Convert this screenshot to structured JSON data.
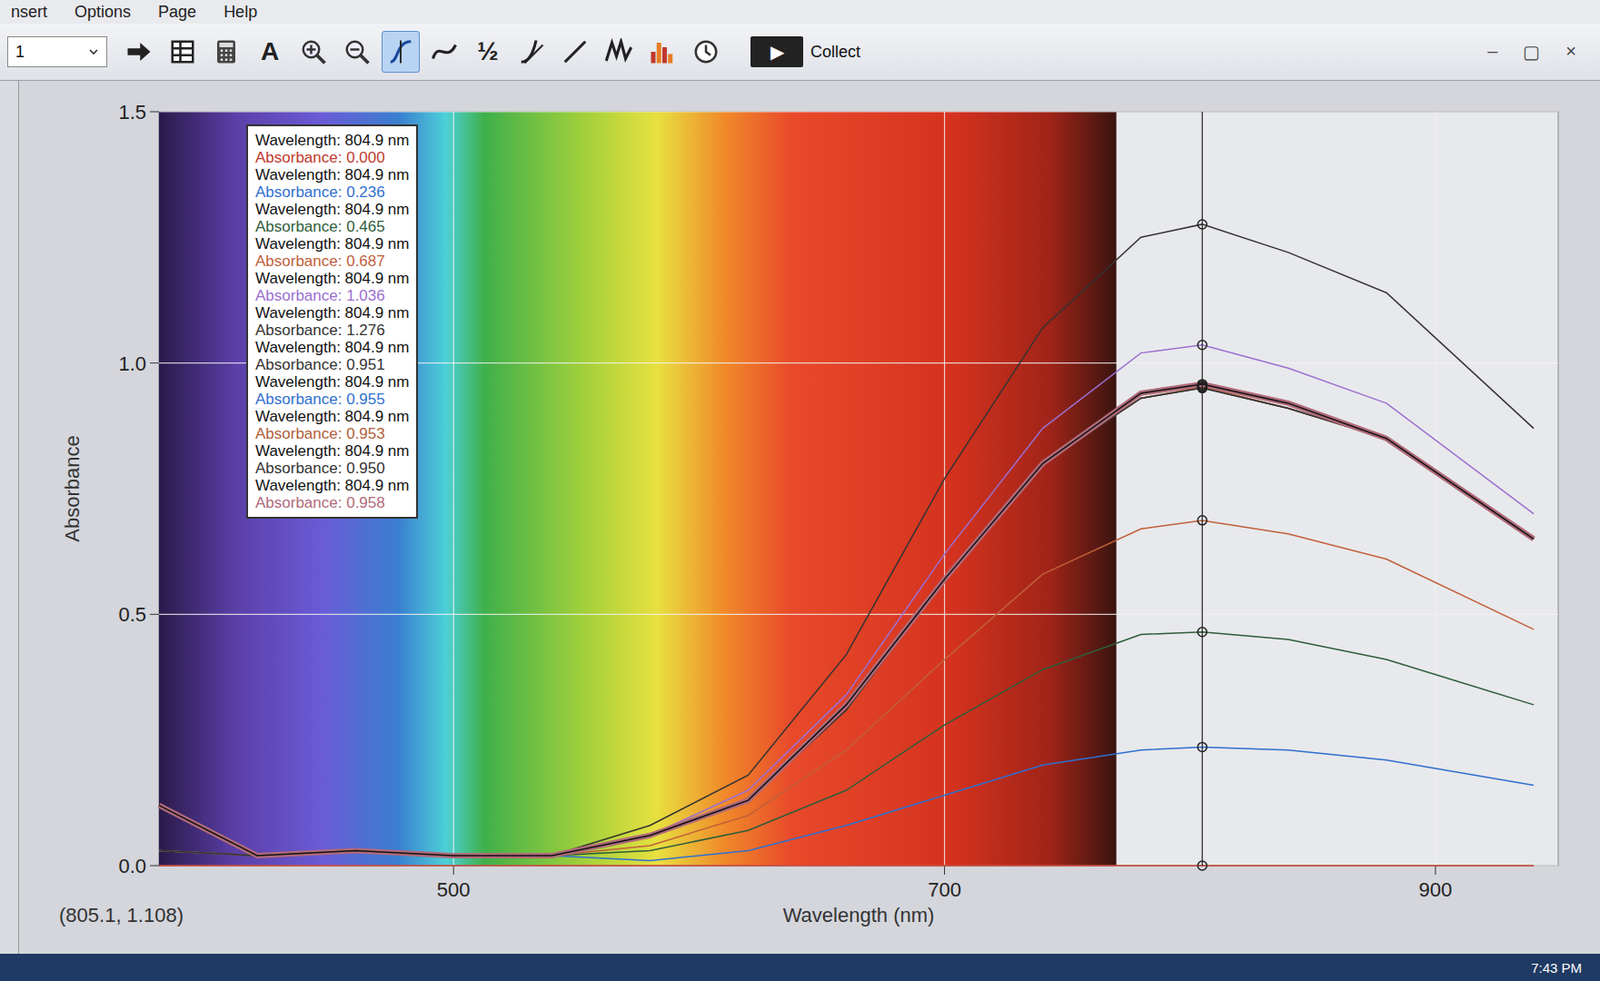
{
  "window": {
    "controls": [
      "–",
      "▢",
      "×"
    ]
  },
  "menu": [
    {
      "label": "nsert"
    },
    {
      "label": "Options"
    },
    {
      "label": "Page"
    },
    {
      "label": "Help"
    }
  ],
  "toolbar": {
    "page_select": "1",
    "buttons": [
      {
        "kind": "arrow",
        "selected": false
      },
      {
        "kind": "table",
        "selected": false
      },
      {
        "kind": "calculator",
        "selected": false
      },
      {
        "kind": "glyph",
        "label": "A",
        "selected": false
      },
      {
        "kind": "zoomin",
        "selected": false
      },
      {
        "kind": "zoomout",
        "selected": false
      },
      {
        "kind": "examine",
        "selected": true
      },
      {
        "kind": "curve",
        "selected": false
      },
      {
        "kind": "glyph",
        "label": "½",
        "selected": false
      },
      {
        "kind": "tangent",
        "selected": false
      },
      {
        "kind": "linear",
        "selected": false
      },
      {
        "kind": "peaks",
        "selected": false
      },
      {
        "kind": "histogram",
        "selected": false
      },
      {
        "kind": "clock",
        "selected": false
      }
    ],
    "collect": {
      "icon": "▶",
      "label": "Collect"
    }
  },
  "chart": {
    "y_axis": {
      "title": "Absorbance",
      "range": [
        0,
        1.5
      ],
      "ticks": [
        {
          "label": "0.0",
          "value": 0
        },
        {
          "label": "0.5",
          "value": 0.5
        },
        {
          "label": "1.0",
          "value": 1.0
        },
        {
          "label": "1.5",
          "value": 1.5
        }
      ]
    },
    "x_axis": {
      "title": "Wavelength (nm)",
      "range": [
        380,
        950
      ],
      "ticks": [
        {
          "label": "500",
          "value": 500
        },
        {
          "label": "700",
          "value": 700
        },
        {
          "label": "900",
          "value": 900
        }
      ]
    },
    "x_values": [
      380,
      420,
      460,
      500,
      540,
      580,
      620,
      660,
      700,
      740,
      780,
      805,
      840,
      880,
      940
    ],
    "cursor": {
      "wavelength": 805
    },
    "series": [
      {
        "wavelength": "Wavelength: 804.9 nm",
        "absorbance": "Absorbance: 0.000",
        "color": "#c0392b",
        "highlighted": false,
        "values": [
          0,
          0,
          0,
          0,
          0,
          0,
          0,
          0,
          0,
          0,
          0,
          0,
          0,
          0,
          0
        ]
      },
      {
        "wavelength": "Wavelength: 804.9 nm",
        "absorbance": "Absorbance: 0.236",
        "color": "#2f6fd0",
        "highlighted": false,
        "values": [
          0.03,
          0.02,
          0.03,
          0.02,
          0.02,
          0.01,
          0.03,
          0.08,
          0.14,
          0.2,
          0.23,
          0.236,
          0.23,
          0.21,
          0.16
        ]
      },
      {
        "wavelength": "Wavelength: 804.9 nm",
        "absorbance": "Absorbance: 0.465",
        "color": "#2e5d3a",
        "highlighted": false,
        "values": [
          0.03,
          0.02,
          0.03,
          0.02,
          0.02,
          0.03,
          0.07,
          0.15,
          0.28,
          0.39,
          0.46,
          0.465,
          0.45,
          0.41,
          0.32
        ]
      },
      {
        "wavelength": "Wavelength: 804.9 nm",
        "absorbance": "Absorbance: 0.687",
        "color": "#c0603a",
        "highlighted": false,
        "values": [
          0.03,
          0.02,
          0.03,
          0.02,
          0.02,
          0.04,
          0.1,
          0.23,
          0.41,
          0.58,
          0.67,
          0.687,
          0.66,
          0.61,
          0.47
        ]
      },
      {
        "wavelength": "Wavelength: 804.9 nm",
        "absorbance": "Absorbance: 1.036",
        "color": "#9b6fd0",
        "highlighted": false,
        "values": [
          0.03,
          0.02,
          0.03,
          0.02,
          0.02,
          0.06,
          0.15,
          0.34,
          0.62,
          0.87,
          1.02,
          1.036,
          0.99,
          0.92,
          0.7
        ]
      },
      {
        "wavelength": "Wavelength: 804.9 nm",
        "absorbance": "Absorbance: 1.276",
        "color": "#333333",
        "highlighted": false,
        "values": [
          0.03,
          0.02,
          0.03,
          0.02,
          0.02,
          0.08,
          0.18,
          0.42,
          0.77,
          1.07,
          1.25,
          1.276,
          1.22,
          1.14,
          0.87
        ]
      },
      {
        "wavelength": "Wavelength: 804.9 nm",
        "absorbance": "Absorbance: 0.951",
        "color": "#333333",
        "highlighted": false,
        "values": [
          0.03,
          0.02,
          0.03,
          0.02,
          0.02,
          0.06,
          0.13,
          0.31,
          0.57,
          0.8,
          0.93,
          0.951,
          0.91,
          0.85,
          0.65
        ]
      },
      {
        "wavelength": "Wavelength: 804.9 nm",
        "absorbance": "Absorbance: 0.955",
        "color": "#2f6fd0",
        "highlighted": false,
        "values": [
          0.03,
          0.02,
          0.03,
          0.02,
          0.02,
          0.06,
          0.13,
          0.32,
          0.57,
          0.8,
          0.94,
          0.955,
          0.92,
          0.85,
          0.65
        ]
      },
      {
        "wavelength": "Wavelength: 804.9 nm",
        "absorbance": "Absorbance: 0.953",
        "color": "#b0603a",
        "highlighted": false,
        "values": [
          0.03,
          0.02,
          0.03,
          0.02,
          0.02,
          0.06,
          0.13,
          0.31,
          0.57,
          0.8,
          0.93,
          0.953,
          0.91,
          0.85,
          0.65
        ]
      },
      {
        "wavelength": "Wavelength: 804.9 nm",
        "absorbance": "Absorbance: 0.950",
        "color": "#333333",
        "highlighted": false,
        "values": [
          0.03,
          0.02,
          0.03,
          0.02,
          0.02,
          0.06,
          0.13,
          0.31,
          0.57,
          0.8,
          0.93,
          0.95,
          0.91,
          0.85,
          0.65
        ]
      },
      {
        "wavelength": "Wavelength: 804.9 nm",
        "absorbance": "Absorbance: 0.958",
        "color": "#b06a7a",
        "highlighted": true,
        "values": [
          0.12,
          0.02,
          0.03,
          0.02,
          0.02,
          0.06,
          0.13,
          0.32,
          0.57,
          0.8,
          0.94,
          0.958,
          0.92,
          0.85,
          0.65
        ]
      }
    ],
    "readout": "(805.1, 1.108)"
  },
  "taskbar": {
    "time": "7:43 PM"
  }
}
